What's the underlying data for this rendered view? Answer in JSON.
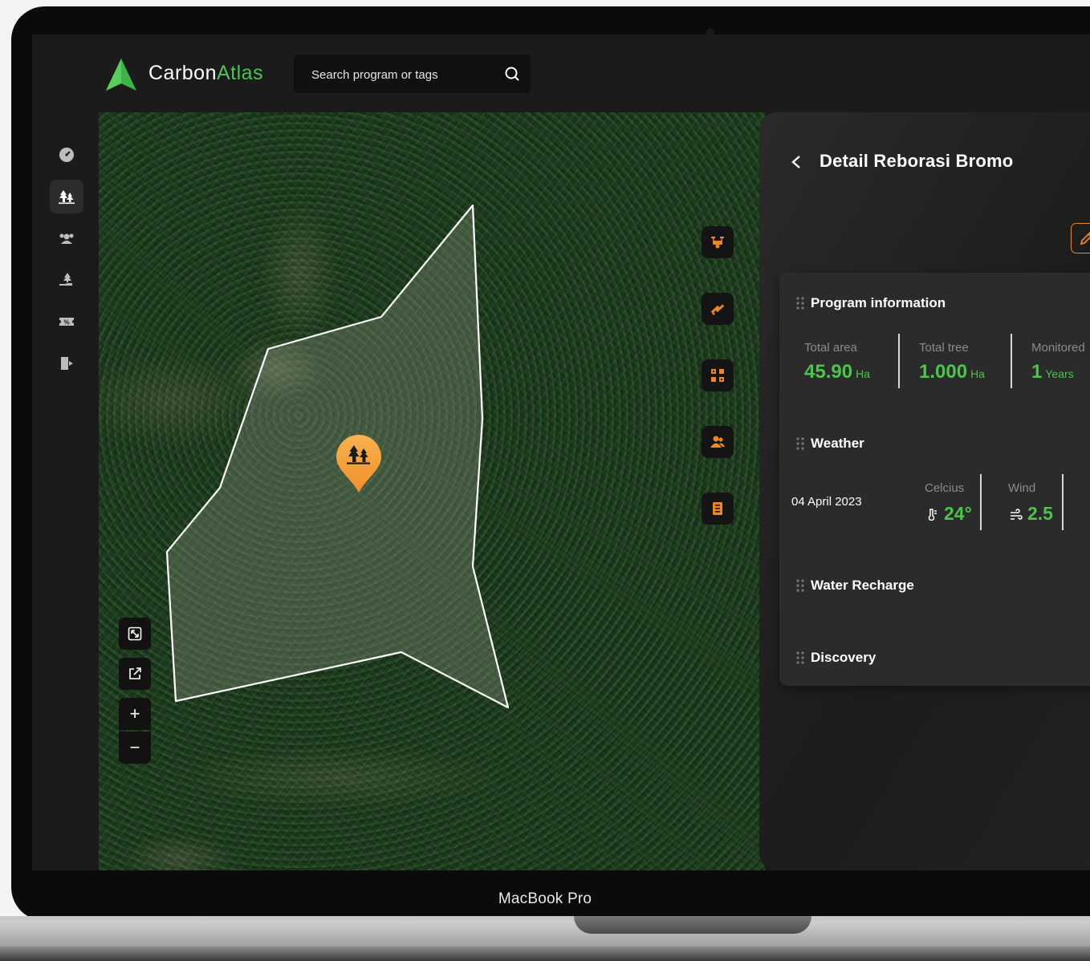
{
  "app": {
    "brand_part1": "Carbon",
    "brand_part2": "Atlas",
    "accent_color": "#4ec34e",
    "warning_color": "#e8882a"
  },
  "search": {
    "placeholder": "Search program or tags",
    "icon": "search-icon"
  },
  "sidebar": {
    "items": [
      {
        "name": "dashboard",
        "icon": "speedometer-icon"
      },
      {
        "name": "programs",
        "icon": "trees-icon",
        "active": true
      },
      {
        "name": "community",
        "icon": "users-icon"
      },
      {
        "name": "planting",
        "icon": "tree-hand-icon"
      },
      {
        "name": "vouchers",
        "icon": "discount-ticket-icon"
      },
      {
        "name": "logout",
        "icon": "logout-icon"
      }
    ]
  },
  "map": {
    "tools": [
      "drone-icon",
      "satellite-icon",
      "area-select-icon",
      "team-icon",
      "report-icon"
    ],
    "controls": [
      "resize-icon",
      "external-link-icon",
      "zoom-in",
      "zoom-out"
    ],
    "zoom_in_label": "+",
    "zoom_out_label": "−",
    "marker_icon": "trees-icon"
  },
  "panel": {
    "title": "Detail Reborasi Bromo",
    "program_information": {
      "heading": "Program information",
      "stats": [
        {
          "label": "Total area",
          "value": "45.90",
          "unit": "Ha"
        },
        {
          "label": "Total tree",
          "value": "1.000",
          "unit": "Ha"
        },
        {
          "label": "Monitored",
          "value": "1",
          "unit": "Years"
        }
      ]
    },
    "weather": {
      "heading": "Weather",
      "date": "04 April 2023",
      "celcius_label": "Celcius",
      "celcius_value": "24°",
      "wind_label": "Wind",
      "wind_value": "2.5"
    },
    "water_recharge": {
      "heading": "Water Recharge"
    },
    "discovery": {
      "heading": "Discovery"
    }
  },
  "device": {
    "model": "MacBook Pro"
  }
}
